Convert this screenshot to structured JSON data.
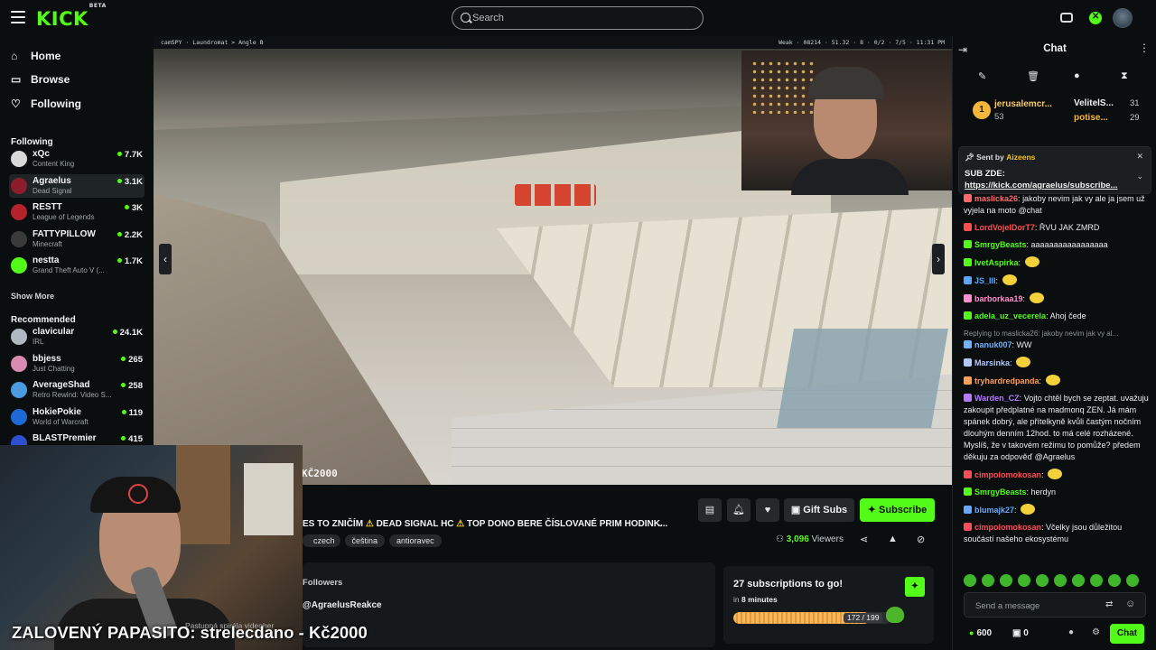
{
  "brand": {
    "logo": "KICK",
    "beta": "BETA",
    "accent": "#53fc18"
  },
  "search": {
    "placeholder": "Search"
  },
  "topbar_icons": [
    "tv-icon",
    "kick-x-icon",
    "user-avatar"
  ],
  "nav": [
    {
      "label": "Home",
      "icon": "home-icon"
    },
    {
      "label": "Browse",
      "icon": "browse-icon"
    },
    {
      "label": "Following",
      "icon": "heart-icon"
    }
  ],
  "following": {
    "heading": "Following",
    "channels": [
      {
        "name": "xQc",
        "game": "Content King",
        "viewers": "7.7K",
        "color": "#d9d9d9"
      },
      {
        "name": "Agraelus",
        "game": "Dead Signal",
        "viewers": "3.1K",
        "color": "#8b1d2c"
      },
      {
        "name": "RESTT",
        "game": "League of Legends",
        "viewers": "3K",
        "color": "#b5222b"
      },
      {
        "name": "FATTYPILLOW",
        "game": "Minecraft",
        "viewers": "2.2K",
        "color": "#3a3a3a"
      },
      {
        "name": "nestta",
        "game": "Grand Theft Auto V (...",
        "viewers": "1.7K",
        "color": "#53fc18"
      }
    ],
    "show_more": "Show More"
  },
  "recommended": {
    "heading": "Recommended",
    "channels": [
      {
        "name": "clavicular",
        "game": "IRL",
        "viewers": "24.1K",
        "color": "#b0b8c2"
      },
      {
        "name": "bbjess",
        "game": "Just Chatting",
        "viewers": "265",
        "color": "#d88ab0"
      },
      {
        "name": "AverageShad",
        "game": "Retro Rewind: Video S...",
        "viewers": "258",
        "color": "#4a9be0"
      },
      {
        "name": "HokiePokie",
        "game": "World of Warcraft",
        "viewers": "119",
        "color": "#1d6ad6"
      },
      {
        "name": "BLASTPremier",
        "game": "",
        "viewers": "415",
        "color": "#2f4fd1"
      }
    ]
  },
  "video": {
    "hud_left": "camSPY · Laundromat > Angle B",
    "hud_right": "Weak · 08214 · 51.32 · 8 · 0/2 · 7/5 · 11:31 PM",
    "prize_overlay": "KČ2000",
    "caption_small": "Pastupná spirála vjdeoher",
    "caption_big": "ZALOVENÝ PAPASITO: strelecdano - Kč2000"
  },
  "stream": {
    "title_parts": [
      "ES TO ZNIČÍM",
      "DEAD SIGNAL HC",
      "TOP DONO BERE ČÍSLOVANÉ PRIM HODINK..."
    ],
    "tags": [
      "czech",
      "čeština",
      "antioravec"
    ],
    "viewers_count": "3,096",
    "viewers_label": "Viewers",
    "gift_label": "Gift Subs",
    "subscribe_label": "Subscribe"
  },
  "about": {
    "followers_label": "Followers",
    "handle": "@AgraelusReakce"
  },
  "goal": {
    "title": "27 subscriptions to go!",
    "time_prefix": "in",
    "time": "8 minutes",
    "progress_text": "172 / 199",
    "progress": 0.864
  },
  "chat": {
    "title": "Chat",
    "leaderboard": [
      {
        "rank": "1",
        "name": "jerusalemcr...",
        "count": "53"
      },
      {
        "name": "VelitelS...",
        "count": "31"
      },
      {
        "name": "potise...",
        "count": "29"
      }
    ],
    "pinned": {
      "sent_by_label": "Sent by",
      "sender": "Aizeens",
      "line1": "SUB ZDE:",
      "line2": "https://kick.com/agraelus/subscribe..."
    },
    "messages": [
      {
        "user": "maslicka26",
        "color": "#ff6b6b",
        "text": "jakoby nevim jak vy ale ja jsem už vyjela na moto @chat"
      },
      {
        "user": "LordVojelDorT7",
        "color": "#ff4d4d",
        "text": "ŘVU JAK ZMRD"
      },
      {
        "user": "SmrgyBeasts",
        "color": "#53fc18",
        "text": "aaaaaaaaaaaaaaaaa"
      },
      {
        "user": "IvetAspirka",
        "color": "#53fc18",
        "text": ""
      },
      {
        "user": "JS_III",
        "color": "#5aa6ff",
        "text": ""
      },
      {
        "user": "barborkaa19",
        "color": "#ff8fd0",
        "text": ""
      },
      {
        "user": "adela_uz_vecerela",
        "color": "#53fc18",
        "text": "Ahoj čede"
      },
      {
        "reply": "Replying to maslicka26: jakoby nevim jak vy al...",
        "user": "nanuk007",
        "color": "#6fb3ff",
        "text": "WW"
      },
      {
        "user": "Marsinka",
        "color": "#b3c7ff",
        "text": ""
      },
      {
        "user": "tryhardredpanda",
        "color": "#ff9f5a",
        "text": ""
      },
      {
        "user": "Warden_CZ",
        "color": "#b47aff",
        "text": "Vojto chtěl bych se zeptat. uvažuju zakoupit předplatné na madmonq ZEN. Já mám spánek dobrý, ale přítelkyně kvůli častým nočním dlouhým denním 12hod. to má celé rozházené. Myslíš, že v takovém režimu to pomůže? předem děkuju za odpověď @Agraelus"
      },
      {
        "user": "cimpolomokosan",
        "color": "#ff4d5a",
        "text": ""
      },
      {
        "user": "SmrgyBeasts",
        "color": "#53fc18",
        "text": "herdyn"
      },
      {
        "user": "blumajk27",
        "color": "#6aa8ff",
        "text": ""
      },
      {
        "user": "cimpolomokosan",
        "color": "#ff4d5a",
        "text": "Včelky jsou důležitou součástí našeho ekosystému"
      }
    ],
    "input_placeholder": "Send a message",
    "points": "600",
    "gifts": "0",
    "send_label": "Chat"
  }
}
